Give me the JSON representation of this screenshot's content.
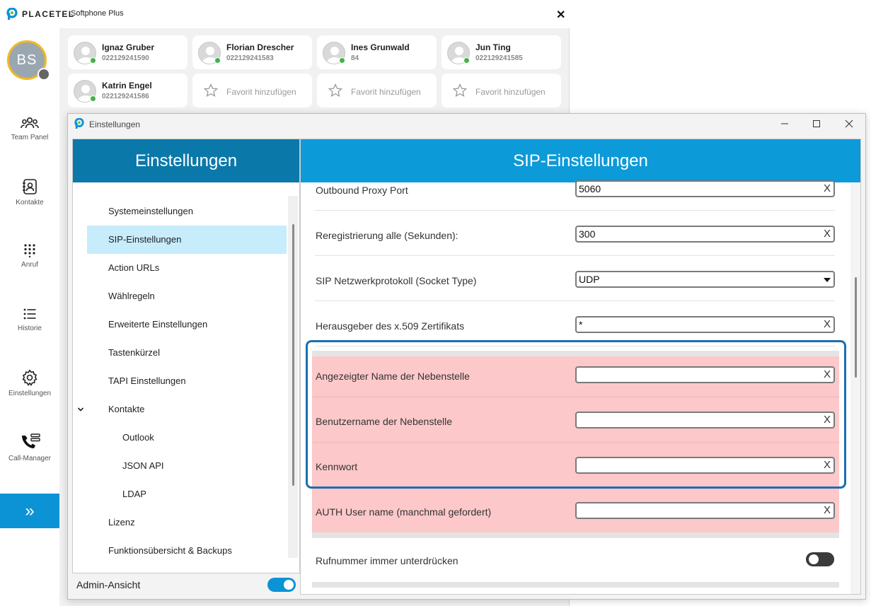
{
  "app": {
    "brand": "PLACETEL",
    "subtitle": "Softphone Plus",
    "close_label": "✕"
  },
  "user": {
    "initials": "BS",
    "status": "offline"
  },
  "sidebar": {
    "items": [
      {
        "label": "Team Panel",
        "icon": "team-icon"
      },
      {
        "label": "Kontakte",
        "icon": "contacts-icon"
      },
      {
        "label": "Anruf",
        "icon": "dialpad-icon"
      },
      {
        "label": "Historie",
        "icon": "history-icon"
      },
      {
        "label": "Einstellungen",
        "icon": "gear-icon"
      },
      {
        "label": "Call-Manager",
        "icon": "call-manager-icon"
      }
    ],
    "expand_icon": "»"
  },
  "team": {
    "contacts": [
      {
        "name": "Ignaz Gruber",
        "number": "022129241590",
        "status": "online"
      },
      {
        "name": "Florian Drescher",
        "number": "022129241583",
        "status": "online"
      },
      {
        "name": "Ines Grunwald",
        "number": "84",
        "status": "online"
      },
      {
        "name": "Jun Ting",
        "number": "022129241585",
        "status": "online"
      },
      {
        "name": "Katrin Engel",
        "number": "022129241586",
        "status": "online"
      }
    ],
    "add_favorite_label": "Favorit hinzufügen"
  },
  "settings": {
    "window_title": "Einstellungen",
    "left_header": "Einstellungen",
    "menu": [
      {
        "label": "Systemeinstellungen"
      },
      {
        "label": "SIP-Einstellungen",
        "active": true
      },
      {
        "label": "Action URLs"
      },
      {
        "label": "Wählregeln"
      },
      {
        "label": "Erweiterte Einstellungen"
      },
      {
        "label": "Tastenkürzel"
      },
      {
        "label": "TAPI Einstellungen"
      },
      {
        "label": "Kontakte",
        "expanded": true
      },
      {
        "label": "Outlook",
        "sub": true
      },
      {
        "label": "JSON API",
        "sub": true
      },
      {
        "label": "LDAP",
        "sub": true
      },
      {
        "label": "Lizenz"
      },
      {
        "label": "Funktionsübersicht & Backups"
      }
    ],
    "admin_view_label": "Admin-Ansicht",
    "admin_view_on": true,
    "right_header": "SIP-Einstellungen",
    "fields": [
      {
        "label": "Outbound Proxy Port",
        "value": "5060",
        "type": "text"
      },
      {
        "label": "Reregistrierung alle (Sekunden):",
        "value": "300",
        "type": "text"
      },
      {
        "label": "SIP Netzwerkprotokoll (Socket Type)",
        "value": "UDP",
        "type": "select"
      },
      {
        "label": "Herausgeber des x.509 Zertifikats",
        "value": "*",
        "type": "text"
      },
      {
        "label": "Angezeigter Name der Nebenstelle",
        "value": "",
        "type": "text",
        "highlighted": true
      },
      {
        "label": "Benutzername der Nebenstelle",
        "value": "",
        "type": "text",
        "highlighted": true
      },
      {
        "label": "Kennwort",
        "value": "",
        "type": "text",
        "highlighted": true
      },
      {
        "label": "AUTH User name (manchmal gefordert)",
        "value": "",
        "type": "text",
        "highlighted": true
      },
      {
        "label": "Rufnummer immer unterdrücken",
        "value": "off",
        "type": "toggle"
      }
    ],
    "clear_glyph": "X",
    "highlight_color": "#fcc8ca",
    "frame_color": "#1a6fb0"
  },
  "colors": {
    "accent": "#0c93d6",
    "header_dark": "#0b78aa",
    "header_light": "#0c9ad9",
    "active_menu": "#c7ecfb",
    "online": "#3cb44a"
  }
}
